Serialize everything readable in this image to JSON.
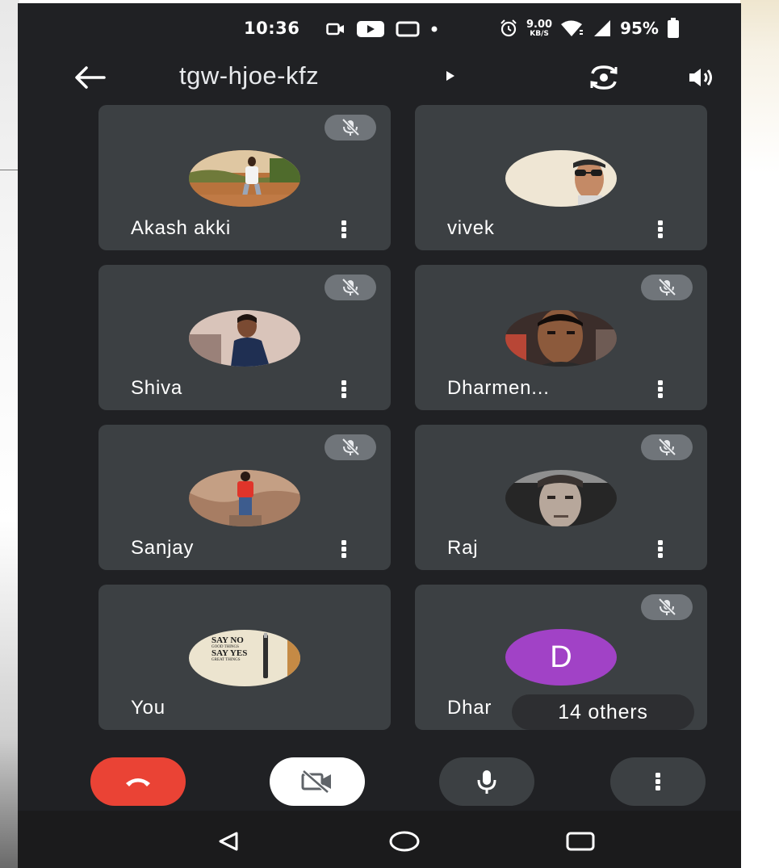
{
  "status_bar": {
    "time": "10:36",
    "speed_value": "9.00",
    "speed_unit": "KB/S",
    "battery": "95%"
  },
  "header": {
    "meeting_code": "tgw-hjoe-kfz"
  },
  "participants": [
    {
      "name": "Akash akki",
      "muted": true
    },
    {
      "name": "vivek",
      "muted": false
    },
    {
      "name": "Shiva",
      "muted": true
    },
    {
      "name": "Dharmen...",
      "muted": true
    },
    {
      "name": "Sanjay",
      "muted": true
    },
    {
      "name": "Raj",
      "muted": true
    },
    {
      "name": "You",
      "muted": false,
      "avatar_text": [
        "SAY NO",
        "GOOD THINGS",
        "SAY YES",
        "GREAT THINGS"
      ]
    },
    {
      "name": "Dhar",
      "muted": true,
      "avatar_letter": "D"
    }
  ],
  "others": {
    "label": "14 others"
  },
  "colors": {
    "background": "#202124",
    "tile": "#3c4043",
    "end_call": "#ea4335",
    "camera_button": "#ffffff",
    "mic_button": "#3c4043",
    "avatar_letter_bg": "#a142c6"
  },
  "controls": {
    "end_call_icon": "phone-hangup-icon",
    "camera_icon": "video-off-icon",
    "mic_icon": "microphone-icon",
    "more_icon": "more-vertical-icon"
  },
  "nav": {
    "back_icon": "nav-back-icon",
    "home_icon": "nav-home-icon",
    "recents_icon": "nav-recents-icon"
  }
}
